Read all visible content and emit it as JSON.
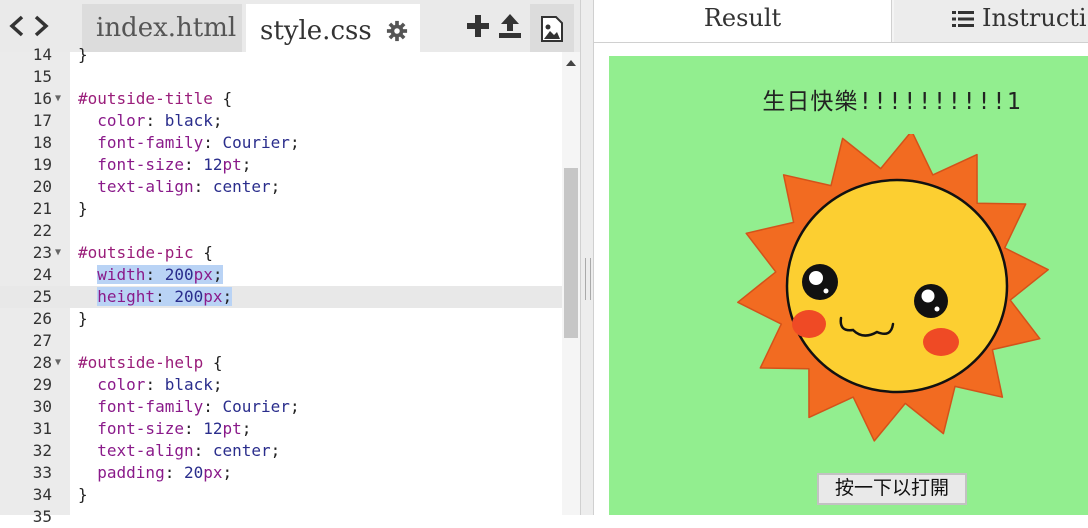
{
  "editor": {
    "tabs": [
      {
        "label": "index.html",
        "active": false
      },
      {
        "label": "style.css",
        "active": true
      }
    ],
    "toolbar_icons": [
      "chevron-left-icon",
      "chevron-right-icon",
      "gear-icon",
      "plus-icon",
      "upload-icon",
      "image-icon"
    ],
    "lines": [
      {
        "num": "14",
        "text": "}"
      },
      {
        "num": "15",
        "text": ""
      },
      {
        "num": "16",
        "text": "#outside-title {",
        "fold": true
      },
      {
        "num": "17",
        "text": "  color: black;"
      },
      {
        "num": "18",
        "text": "  font-family: Courier;"
      },
      {
        "num": "19",
        "text": "  font-size: 12pt;"
      },
      {
        "num": "20",
        "text": "  text-align: center;"
      },
      {
        "num": "21",
        "text": "}"
      },
      {
        "num": "22",
        "text": ""
      },
      {
        "num": "23",
        "text": "#outside-pic {",
        "fold": true
      },
      {
        "num": "24",
        "text": "  width: 200px;",
        "selected": true
      },
      {
        "num": "25",
        "text": "  height: 200px;",
        "selected": true,
        "active": true
      },
      {
        "num": "26",
        "text": "}"
      },
      {
        "num": "27",
        "text": ""
      },
      {
        "num": "28",
        "text": "#outside-help {",
        "fold": true
      },
      {
        "num": "29",
        "text": "  color: black;"
      },
      {
        "num": "30",
        "text": "  font-family: Courier;"
      },
      {
        "num": "31",
        "text": "  font-size: 12pt;"
      },
      {
        "num": "32",
        "text": "  text-align: center;"
      },
      {
        "num": "33",
        "text": "  padding: 20px;"
      },
      {
        "num": "34",
        "text": "}"
      },
      {
        "num": "35",
        "text": ""
      }
    ]
  },
  "result": {
    "tabs": [
      {
        "label": "Result",
        "active": true
      },
      {
        "label": "Instructi",
        "icon": "list-icon",
        "active": false
      }
    ],
    "preview": {
      "background": "#92ee8f",
      "title": "生日快樂!!!!!!!!!!1",
      "image": "smiling-sun-image",
      "button_label": "按一下以打開"
    }
  },
  "colors": {
    "selector": "#9a1d7a",
    "property": "#8a1a8a",
    "value": "#2a2d8c",
    "selection": "#b9d3f5",
    "sun_rays": "#f26b21",
    "sun_face": "#fccf31",
    "cheeks": "#ef4a25"
  }
}
